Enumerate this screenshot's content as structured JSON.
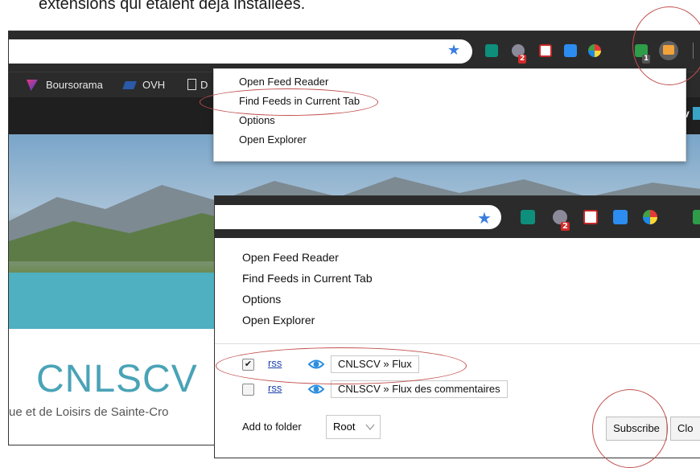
{
  "caption": "extensions qui étaient déjà installées.",
  "back_window": {
    "bookmarks": [
      "Boursorama",
      "OVH",
      "D"
    ],
    "badge_numbers": [
      "2",
      "1"
    ],
    "menu_items": [
      "Open Feed Reader",
      "Find Feeds in Current Tab",
      "Options",
      "Open Explorer"
    ],
    "site": {
      "title": "CNLSCV",
      "subtitle": "ue et de Loisirs de Sainte-Cro",
      "clipped_letter": "v"
    }
  },
  "front_window": {
    "badge_number": "2",
    "menu_items": [
      "Open Feed Reader",
      "Find Feeds in Current Tab",
      "Options",
      "Open Explorer"
    ],
    "feeds": [
      {
        "checked": true,
        "link": "rss",
        "name": "CNLSCV » Flux"
      },
      {
        "checked": false,
        "link": "rss",
        "name": "CNLSCV » Flux des commentaires"
      }
    ],
    "folder_label": "Add to folder",
    "folder_value": "Root",
    "subscribe_label": "Subscribe",
    "close_label": "Clo"
  },
  "colors": {
    "toolbar": "#2b2b2b",
    "annotation": "#c0504d",
    "accent_blue": "#3a7de0",
    "site_title": "#4aa3b7"
  },
  "icons": [
    "star-icon",
    "stylish-icon",
    "puzzle-icon",
    "pdf-icon",
    "cloud-icon",
    "color-picker-icon",
    "shield-icon",
    "feed-reader-icon",
    "eye-icon",
    "check-icon",
    "dropdown-arrow-icon"
  ]
}
